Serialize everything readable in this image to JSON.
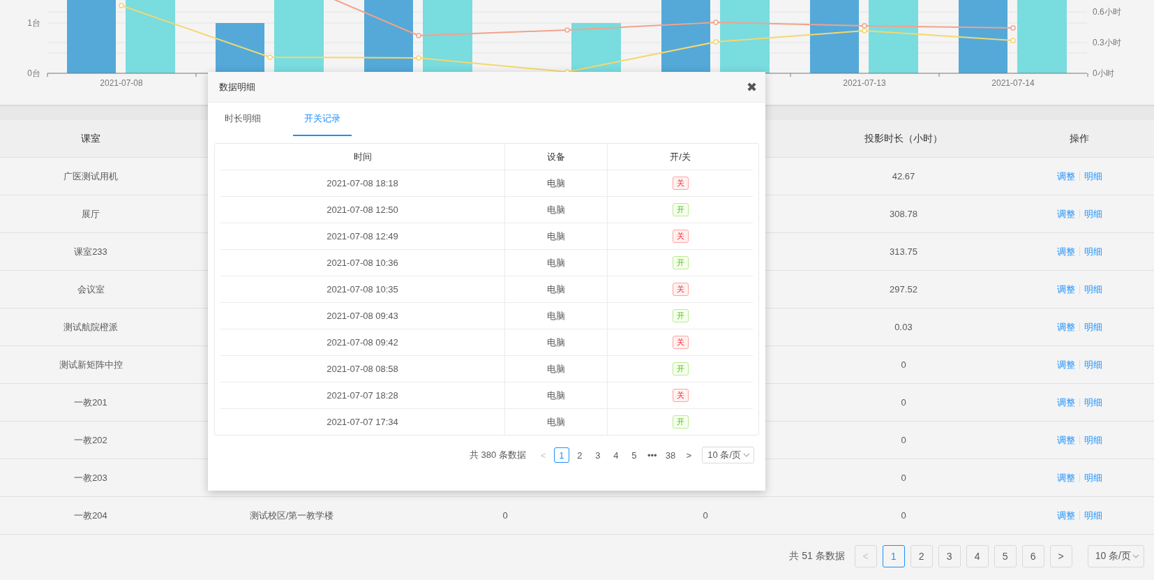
{
  "chart": {
    "y_left_ticks": [
      "1台",
      "0台"
    ],
    "y_right_ticks": [
      "0.6小时",
      "0.3小时",
      "0小时"
    ],
    "x_labels": [
      "2021-07-08",
      "2021-07-13",
      "2021-07-14"
    ]
  },
  "table": {
    "header": {
      "room": "课室",
      "projection_hours": "投影时长（小时）",
      "actions": "操作"
    },
    "rows": [
      {
        "room": "广医测试用机",
        "projection_hours": "42.67",
        "actions": [
          "调整",
          "明细"
        ]
      },
      {
        "room": "展厅",
        "projection_hours": "308.78",
        "actions": [
          "调整",
          "明细"
        ]
      },
      {
        "room": "课室233",
        "projection_hours": "313.75",
        "actions": [
          "调整",
          "明细"
        ]
      },
      {
        "room": "会议室",
        "projection_hours": "297.52",
        "actions": [
          "调整",
          "明细"
        ]
      },
      {
        "room": "测试航院橙派",
        "projection_hours": "0.03",
        "actions": [
          "调整",
          "明细"
        ]
      },
      {
        "room": "测试新矩阵中控",
        "projection_hours": "0",
        "actions": [
          "调整",
          "明细"
        ]
      },
      {
        "room": "一教201",
        "projection_hours": "0",
        "actions": [
          "调整",
          "明细"
        ]
      },
      {
        "room": "一教202",
        "projection_hours": "0",
        "actions": [
          "调整",
          "明细"
        ]
      },
      {
        "room": "一教203",
        "projection_hours": "0",
        "actions": [
          "调整",
          "明细"
        ]
      },
      {
        "room": "一教204",
        "location": "测试校区/第一教学楼",
        "column_3": "0",
        "column_4": "0",
        "projection_hours": "0",
        "actions": [
          "调整",
          "明细"
        ]
      }
    ]
  },
  "pagination": {
    "total": "共 51 条数据",
    "prev": {
      "label": "<",
      "disabled": true
    },
    "pages": [
      {
        "label": "1",
        "selected": true
      },
      {
        "label": "2",
        "selected": false
      },
      {
        "label": "3",
        "selected": false
      },
      {
        "label": "4",
        "selected": false
      },
      {
        "label": "5",
        "selected": false
      },
      {
        "label": "6",
        "selected": false
      }
    ],
    "next": {
      "label": ">",
      "disabled": false
    },
    "page_size": "10 条/页"
  },
  "dialog": {
    "title": "数据明细",
    "close": "✖",
    "tabs": [
      {
        "label": "时长明细",
        "selected": false
      },
      {
        "label": "开关记录",
        "selected": true
      }
    ],
    "columns": [
      "时间",
      "设备",
      "开/关"
    ],
    "records": [
      {
        "time": "2021-07-08 18:18",
        "device": "电脑",
        "state": "关",
        "kind": "off"
      },
      {
        "time": "2021-07-08 12:50",
        "device": "电脑",
        "state": "开",
        "kind": "on"
      },
      {
        "time": "2021-07-08 12:49",
        "device": "电脑",
        "state": "关",
        "kind": "off"
      },
      {
        "time": "2021-07-08 10:36",
        "device": "电脑",
        "state": "开",
        "kind": "on"
      },
      {
        "time": "2021-07-08 10:35",
        "device": "电脑",
        "state": "关",
        "kind": "off"
      },
      {
        "time": "2021-07-08 09:43",
        "device": "电脑",
        "state": "开",
        "kind": "on"
      },
      {
        "time": "2021-07-08 09:42",
        "device": "电脑",
        "state": "关",
        "kind": "off"
      },
      {
        "time": "2021-07-08 08:58",
        "device": "电脑",
        "state": "开",
        "kind": "on"
      },
      {
        "time": "2021-07-07 18:28",
        "device": "电脑",
        "state": "关",
        "kind": "off"
      },
      {
        "time": "2021-07-07 17:34",
        "device": "电脑",
        "state": "开",
        "kind": "on"
      }
    ],
    "pagination": {
      "total": "共 380 条数据",
      "prev": {
        "label": "<",
        "disabled": true
      },
      "pages": [
        {
          "label": "1",
          "selected": true
        },
        {
          "label": "2",
          "selected": false
        },
        {
          "label": "3",
          "selected": false
        },
        {
          "label": "4",
          "selected": false
        },
        {
          "label": "5",
          "selected": false
        },
        {
          "label": "•••",
          "selected": false
        },
        {
          "label": "38",
          "selected": false
        }
      ],
      "next": {
        "label": ">",
        "disabled": false
      },
      "page_size": "10 条/页"
    }
  }
}
